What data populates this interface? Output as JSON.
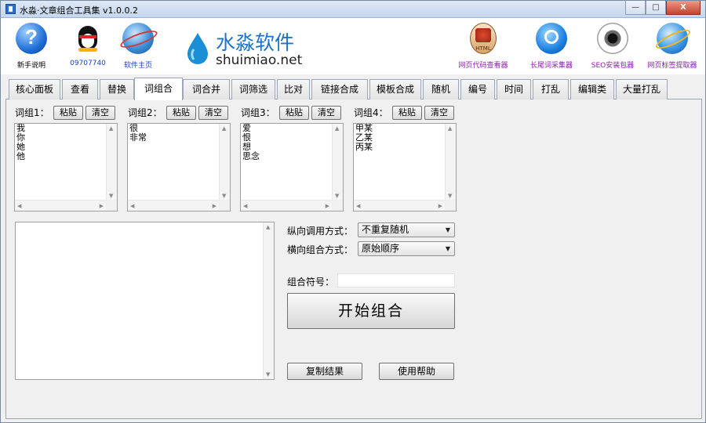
{
  "window": {
    "title": "水淼·文章组合工具集 v1.0.0.2",
    "minimize_label": "—",
    "maximize_label": "□",
    "close_label": "X"
  },
  "toolbar": {
    "items": [
      {
        "label": "新手说明",
        "icon": "help-icon"
      },
      {
        "label": "09707740",
        "icon": "qq-penguin-icon"
      },
      {
        "label": "软件主页",
        "icon": "globe-icon"
      },
      {
        "label": "网页代码查看器",
        "icon": "html-file-icon"
      },
      {
        "label": "长尾词采集器",
        "icon": "magnifier-globe-icon"
      },
      {
        "label": "SEO安装包器",
        "icon": "eye-icon"
      },
      {
        "label": "网页标签提取器",
        "icon": "ie-globe-icon"
      }
    ],
    "logo": {
      "name": "水淼软件",
      "url": "shuimiao.net"
    }
  },
  "tabs": [
    "核心面板",
    "查看",
    "替换",
    "词组合",
    "词合并",
    "词筛选",
    "比对",
    "链接合成",
    "模板合成",
    "随机",
    "编号",
    "时间",
    "打乱",
    "编辑类",
    "大量打乱"
  ],
  "active_tab": "词组合",
  "groups": [
    {
      "label": "词组1：",
      "paste": "粘贴",
      "clear": "清空",
      "words": "我\n你\n她\n他"
    },
    {
      "label": "词组2：",
      "paste": "粘贴",
      "clear": "清空",
      "words": "很\n非常"
    },
    {
      "label": "词组3：",
      "paste": "粘贴",
      "clear": "清空",
      "words": "爱\n恨\n想\n思念"
    },
    {
      "label": "词组4：",
      "paste": "粘贴",
      "clear": "清空",
      "words": "甲某\n乙某\n丙某"
    }
  ],
  "options": {
    "vertical_label": "纵向调用方式：",
    "vertical_value": "不重复随机",
    "horizontal_label": "横向组合方式：",
    "horizontal_value": "原始顺序",
    "separator_label": "组合符号：",
    "separator_value": ""
  },
  "buttons": {
    "start": "开始组合",
    "copy": "复制结果",
    "help": "使用帮助"
  },
  "colors": {
    "logo_blue": "#1d73c9",
    "label_blue": "#1e40c8",
    "label_purple": "#8a21a8"
  }
}
